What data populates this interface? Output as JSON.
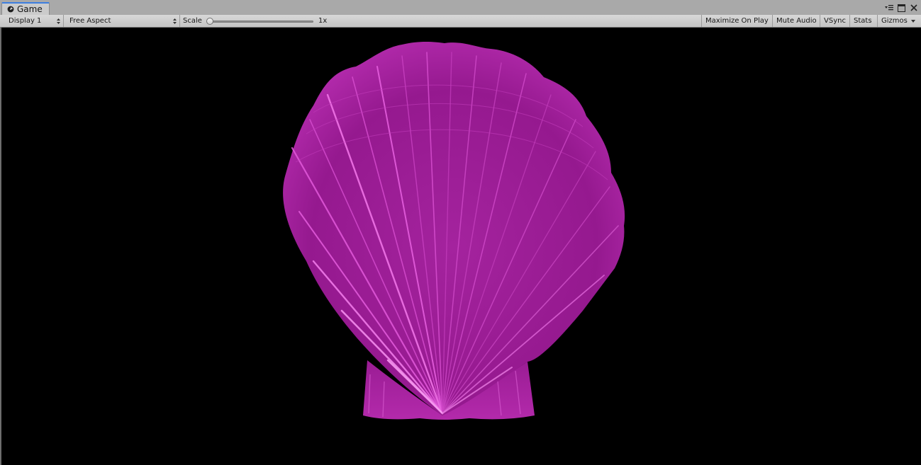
{
  "window": {
    "tab_title": "Game",
    "tab_icon": "unity-game-icon",
    "controls": [
      "menu-icon",
      "maximize-icon",
      "close-icon"
    ]
  },
  "toolbar": {
    "display_dropdown": "Display 1",
    "aspect_dropdown": "Free Aspect",
    "scale_label": "Scale",
    "scale_value": "1x",
    "scale_slider_fraction": 0,
    "buttons": {
      "maximize_on_play": "Maximize On Play",
      "mute_audio": "Mute Audio",
      "vsync": "VSync",
      "stats": "Stats",
      "gizmos": "Gizmos"
    }
  },
  "viewport": {
    "background": "#000000",
    "object": "scallop-shell-3d-model",
    "object_color": "#a0209a",
    "highlight_color": "#e86ae0"
  }
}
